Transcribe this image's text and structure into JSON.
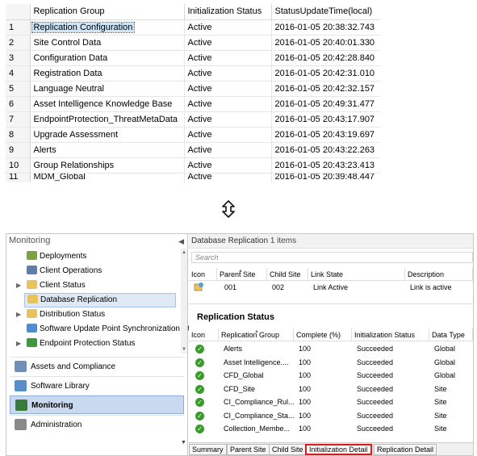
{
  "results": {
    "columns": [
      "",
      "Replication Group",
      "Initialization Status",
      "StatusUpdateTime(local)"
    ],
    "rows": [
      {
        "n": "1",
        "group": "Replication Configuration",
        "status": "Active",
        "time": "2016-01-05 20:38:32.743"
      },
      {
        "n": "2",
        "group": "Site Control Data",
        "status": "Active",
        "time": "2016-01-05 20:40:01.330"
      },
      {
        "n": "3",
        "group": "Configuration Data",
        "status": "Active",
        "time": "2016-01-05 20:42:28.840"
      },
      {
        "n": "4",
        "group": "Registration Data",
        "status": "Active",
        "time": "2016-01-05 20:42:31.010"
      },
      {
        "n": "5",
        "group": "Language Neutral",
        "status": "Active",
        "time": "2016-01-05 20:42:32.157"
      },
      {
        "n": "6",
        "group": "Asset Intelligence Knowledge Base",
        "status": "Active",
        "time": "2016-01-05 20:49:31.477"
      },
      {
        "n": "7",
        "group": "EndpointProtection_ThreatMetaData",
        "status": "Active",
        "time": "2016-01-05 20:43:17.907"
      },
      {
        "n": "8",
        "group": "Upgrade Assessment",
        "status": "Active",
        "time": "2016-01-05 20:43:19.697"
      },
      {
        "n": "9",
        "group": "Alerts",
        "status": "Active",
        "time": "2016-01-05 20:43:22.263"
      },
      {
        "n": "10",
        "group": "Group Relationships",
        "status": "Active",
        "time": "2016-01-05 20:43:23.413"
      },
      {
        "n": "11",
        "group": "MDM_Global",
        "status": "Active",
        "time": "2016-01-05 20:39:48.447"
      }
    ]
  },
  "nav": {
    "title": "Monitoring",
    "collapse_icon": "chevron-left-icon",
    "tree": [
      {
        "label": "Deployments",
        "icon": "deployments-icon",
        "color": "#7aa23f"
      },
      {
        "label": "Client Operations",
        "icon": "client-operations-icon",
        "color": "#5d7fa8"
      },
      {
        "label": "Client Status",
        "icon": "folder-icon",
        "color": "#e8c35c"
      },
      {
        "label": "Database Replication",
        "icon": "folder-icon",
        "color": "#e8c35c"
      },
      {
        "label": "Distribution Status",
        "icon": "folder-icon",
        "color": "#e8c35c"
      },
      {
        "label": "Software Update Point Synchronization Sta",
        "icon": "sync-icon",
        "color": "#4a8fd6"
      },
      {
        "label": "Endpoint Protection Status",
        "icon": "shield-icon",
        "color": "#3c9a3c"
      }
    ],
    "workspaces": [
      {
        "label": "Assets and Compliance",
        "icon": "assets-icon",
        "color": "#6f8fb5"
      },
      {
        "label": "Software Library",
        "icon": "software-library-icon",
        "color": "#5a8ccc"
      },
      {
        "label": "Monitoring",
        "icon": "monitoring-icon",
        "color": "#3a7a3a"
      },
      {
        "label": "Administration",
        "icon": "administration-icon",
        "color": "#8a8a8a"
      }
    ]
  },
  "pane": {
    "header_title": "Database Replication",
    "header_count": "1 items",
    "search_placeholder": "Search",
    "links": {
      "columns": [
        "Icon",
        "Parent Site",
        "Child Site",
        "Link State",
        "Description"
      ],
      "row": {
        "parent": "001",
        "child": "002",
        "state": "Link Active",
        "desc": "Link is active"
      }
    },
    "status_title": "Replication Status",
    "status": {
      "columns": [
        "Icon",
        "Replication Group",
        "Complete (%)",
        "Initialization Status",
        "Data Type"
      ],
      "rows": [
        {
          "group": "Alerts",
          "complete": "100",
          "status": "Succeeded",
          "type": "Global"
        },
        {
          "group": "Asset Intelligence....",
          "complete": "100",
          "status": "Succeeded",
          "type": "Global"
        },
        {
          "group": "CFD_Global",
          "complete": "100",
          "status": "Succeeded",
          "type": "Global"
        },
        {
          "group": "CFD_Site",
          "complete": "100",
          "status": "Succeeded",
          "type": "Site"
        },
        {
          "group": "CI_Compliance_Rul...",
          "complete": "100",
          "status": "Succeeded",
          "type": "Site"
        },
        {
          "group": "CI_Compliance_Sta...",
          "complete": "100",
          "status": "Succeeded",
          "type": "Site"
        },
        {
          "group": "Collection_Membe...",
          "complete": "100",
          "status": "Succeeded",
          "type": "Site"
        }
      ]
    },
    "tabs": [
      "Summary",
      "Parent Site",
      "Child Site",
      "Initialization Detail",
      "Replication Detail"
    ],
    "highlight_color": "#e01717"
  }
}
